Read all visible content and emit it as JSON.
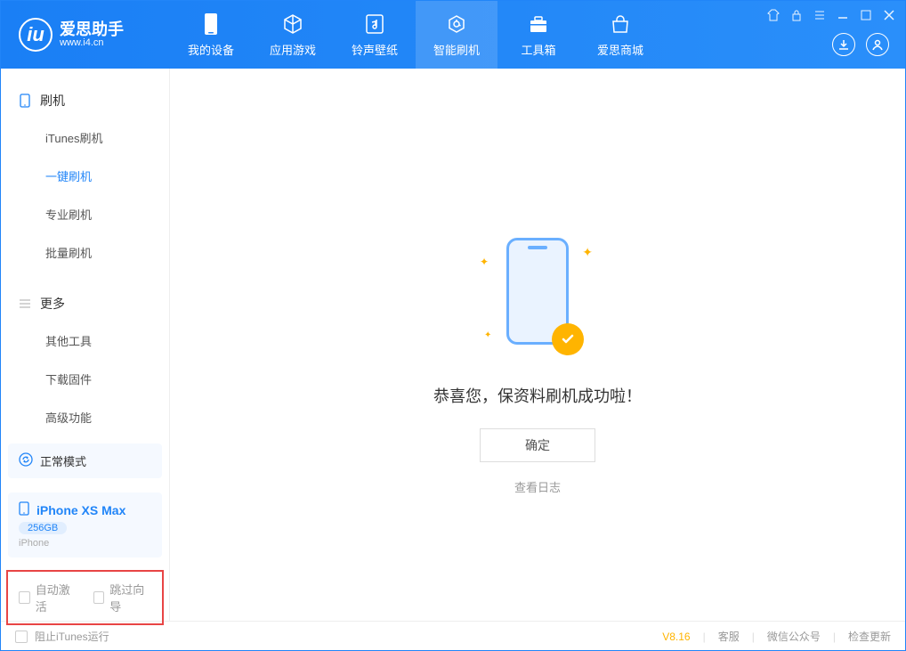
{
  "app": {
    "name": "爱思助手",
    "sub": "www.i4.cn"
  },
  "nav": {
    "items": [
      {
        "label": "我的设备"
      },
      {
        "label": "应用游戏"
      },
      {
        "label": "铃声壁纸"
      },
      {
        "label": "智能刷机"
      },
      {
        "label": "工具箱"
      },
      {
        "label": "爱思商城"
      }
    ]
  },
  "sidebar": {
    "group1": {
      "title": "刷机",
      "items": [
        "iTunes刷机",
        "一键刷机",
        "专业刷机",
        "批量刷机"
      ]
    },
    "group2": {
      "title": "更多",
      "items": [
        "其他工具",
        "下载固件",
        "高级功能"
      ]
    }
  },
  "device": {
    "mode": "正常模式",
    "name": "iPhone XS Max",
    "capacity": "256GB",
    "type": "iPhone"
  },
  "checkboxes": {
    "auto_activate": "自动激活",
    "skip_wizard": "跳过向导"
  },
  "main": {
    "success_text": "恭喜您，保资料刷机成功啦！",
    "ok": "确定",
    "view_log": "查看日志"
  },
  "footer": {
    "block_itunes": "阻止iTunes运行",
    "version": "V8.16",
    "links": [
      "客服",
      "微信公众号",
      "检查更新"
    ]
  }
}
